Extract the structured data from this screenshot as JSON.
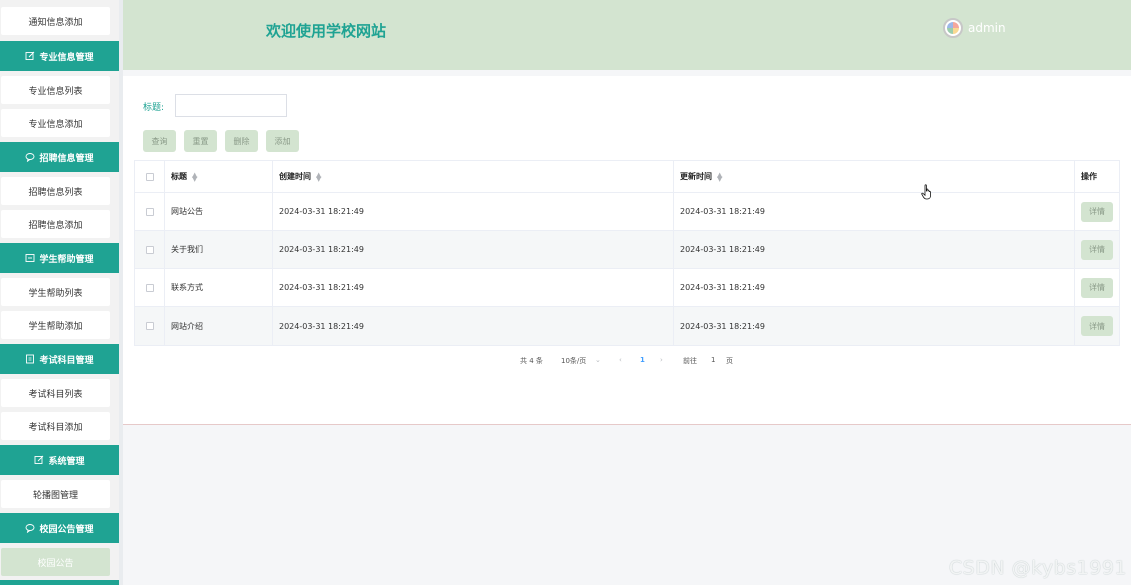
{
  "sidebar": {
    "items": [
      {
        "kind": "sub",
        "label": "通知信息添加"
      },
      {
        "kind": "group",
        "label": "专业信息管理",
        "icon": "edit-icon"
      },
      {
        "kind": "sub",
        "label": "专业信息列表"
      },
      {
        "kind": "sub",
        "label": "专业信息添加"
      },
      {
        "kind": "group",
        "label": "招聘信息管理",
        "icon": "chat-icon"
      },
      {
        "kind": "sub",
        "label": "招聘信息列表"
      },
      {
        "kind": "sub",
        "label": "招聘信息添加"
      },
      {
        "kind": "group",
        "label": "学生帮助管理",
        "icon": "message-icon"
      },
      {
        "kind": "sub",
        "label": "学生帮助列表"
      },
      {
        "kind": "sub",
        "label": "学生帮助添加"
      },
      {
        "kind": "group",
        "label": "考试科目管理",
        "icon": "document-icon"
      },
      {
        "kind": "sub",
        "label": "考试科目列表"
      },
      {
        "kind": "sub",
        "label": "考试科目添加"
      },
      {
        "kind": "group",
        "label": "系统管理",
        "icon": "edit-icon"
      },
      {
        "kind": "sub",
        "label": "轮播图管理"
      },
      {
        "kind": "group",
        "label": "校园公告管理",
        "icon": "chat-icon"
      },
      {
        "kind": "sub",
        "label": "校园公告",
        "active": true
      }
    ]
  },
  "header": {
    "title": "欢迎使用学校网站",
    "user": "admin"
  },
  "search": {
    "label": "标题:",
    "value": ""
  },
  "buttons": {
    "query": "查询",
    "reset": "重置",
    "delete": "删除",
    "add": "添加"
  },
  "table": {
    "headers": {
      "title": "标题",
      "created": "创建时间",
      "updated": "更新时间",
      "op": "操作"
    },
    "rows": [
      {
        "title": "网站公告",
        "created": "2024-03-31 18:21:49",
        "updated": "2024-03-31 18:21:49",
        "action": "详情"
      },
      {
        "title": "关于我们",
        "created": "2024-03-31 18:21:49",
        "updated": "2024-03-31 18:21:49",
        "action": "详情"
      },
      {
        "title": "联系方式",
        "created": "2024-03-31 18:21:49",
        "updated": "2024-03-31 18:21:49",
        "action": "详情"
      },
      {
        "title": "网站介绍",
        "created": "2024-03-31 18:21:49",
        "updated": "2024-03-31 18:21:49",
        "action": "详情"
      }
    ]
  },
  "pagination": {
    "total": "共 4 条",
    "page_size": "10条/页",
    "current": "1",
    "goto_prefix": "前往",
    "goto_value": "1",
    "goto_suffix": "页"
  },
  "watermark": "CSDN @kybs1991",
  "colors": {
    "accent": "#1fa393",
    "header_bg": "#d3e4d0",
    "button_bg": "#d3e4d0",
    "link": "#409eff"
  }
}
